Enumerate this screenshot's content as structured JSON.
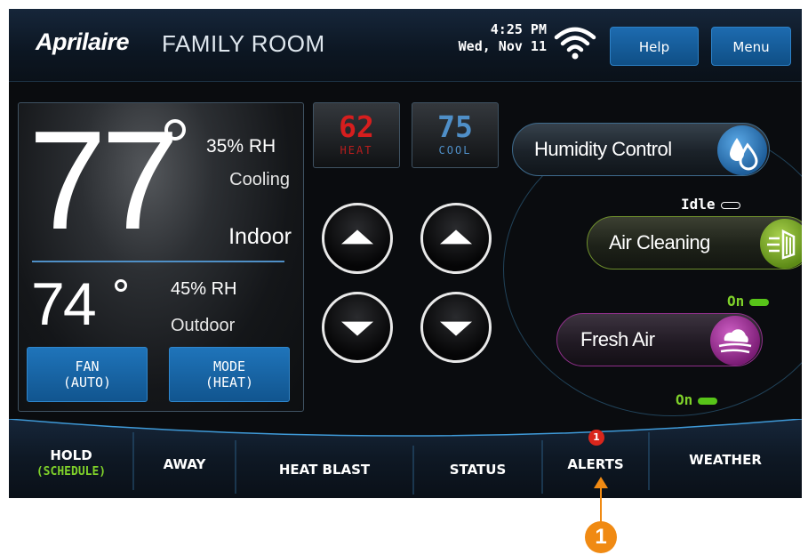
{
  "header": {
    "brand": "Aprilaire",
    "room": "FAMILY ROOM",
    "time": "4:25 PM",
    "date": "Wed, Nov 11",
    "help_label": "Help",
    "menu_label": "Menu"
  },
  "indoor": {
    "temp": "77",
    "humidity": "35% RH",
    "status": "Cooling",
    "label": "Indoor"
  },
  "outdoor": {
    "temp": "74",
    "humidity": "45% RH",
    "label": "Outdoor"
  },
  "controls": {
    "fan_label": "FAN",
    "fan_value": "(AUTO)",
    "mode_label": "MODE",
    "mode_value": "(HEAT)"
  },
  "setpoints": {
    "heat_value": "62",
    "heat_label": "HEAT",
    "cool_value": "75",
    "cool_label": "COOL"
  },
  "features": {
    "humidity_label": "Humidity Control",
    "humidity_status": "Idle",
    "air_label": "Air Cleaning",
    "air_status": "On",
    "fresh_label": "Fresh Air",
    "fresh_status": "On"
  },
  "nav": {
    "hold": "HOLD",
    "hold_sub": "(SCHEDULE)",
    "away": "AWAY",
    "heat_blast": "HEAT BLAST",
    "status": "STATUS",
    "alerts": "ALERTS",
    "alerts_badge": "1",
    "weather": "WEATHER"
  },
  "callout": {
    "number": "1"
  },
  "colors": {
    "accent_blue": "#1f74ba",
    "heat_red": "#d61e1e",
    "cool_blue": "#4f8fc8",
    "status_green": "#7fd12a",
    "callout_orange": "#f08a13",
    "humidity_ball": "#1f5f9b",
    "air_ball": "#5c8a16",
    "fresh_ball": "#7b1c75"
  }
}
